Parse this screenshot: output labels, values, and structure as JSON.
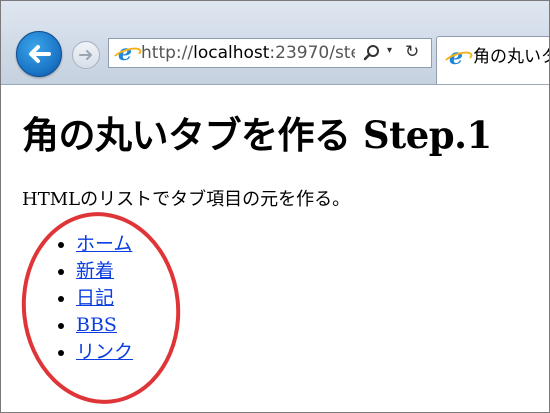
{
  "browser": {
    "url_prefix": "http://",
    "url_host": "localhost",
    "url_rest": ":23970/ste",
    "tab_title": "角の丸いタブ",
    "icons": [
      "back-icon",
      "forward-icon",
      "ie-icon",
      "search-icon",
      "dropdown-icon",
      "refresh-icon"
    ]
  },
  "page": {
    "heading": "角の丸いタブを作る Step.1",
    "intro": "HTMLのリストでタブ項目の元を作る。",
    "tabs": [
      "ホーム",
      "新着",
      "日記",
      "BBS",
      "リンク"
    ]
  },
  "colors": {
    "link": "#0b3ee0",
    "annotation_circle": "#e03538",
    "back_button": "#1a74c6"
  }
}
